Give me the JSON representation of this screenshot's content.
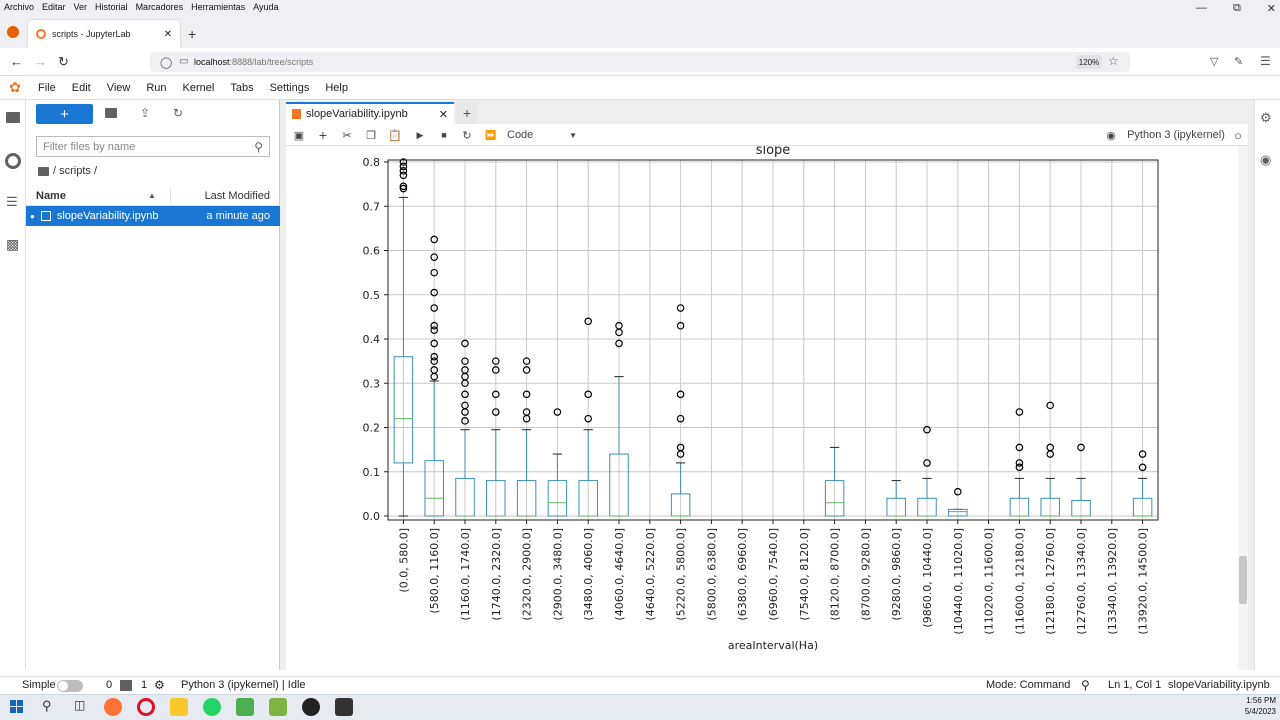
{
  "firefox_menu": [
    "Archivo",
    "Editar",
    "Ver",
    "Historial",
    "Marcadores",
    "Herramientas",
    "Ayuda"
  ],
  "browser_tab": {
    "title": "scripts - JupyterLab"
  },
  "url": {
    "host": "localhost",
    "path": ":8888/lab/tree/scripts"
  },
  "zoom": "120%",
  "jl_menu": [
    "File",
    "Edit",
    "View",
    "Run",
    "Kernel",
    "Tabs",
    "Settings",
    "Help"
  ],
  "filebrowser": {
    "new_label": "+",
    "filter_placeholder": "Filter files by name",
    "breadcrumb": "/ scripts /",
    "col_name": "Name",
    "col_modified": "Last Modified",
    "files": [
      {
        "name": "slopeVariability.ipynb",
        "modified": "a minute ago"
      }
    ]
  },
  "notebook": {
    "tab_title": "slopeVariability.ipynb",
    "cell_type": "Code",
    "kernel": "Python 3 (ipykernel)"
  },
  "chart_data": {
    "type": "boxplot",
    "title": "slope",
    "xlabel": "areaInterval(Ha)",
    "ylim": [
      0,
      0.8
    ],
    "yticks": [
      "0.0",
      "0.1",
      "0.2",
      "0.3",
      "0.4",
      "0.5",
      "0.6",
      "0.7",
      "0.8"
    ],
    "grid": true,
    "categories": [
      "(0.0, 580.0]",
      "(580.0, 1160.0]",
      "(1160.0, 1740.0]",
      "(1740.0, 2320.0]",
      "(2320.0, 2900.0]",
      "(2900.0, 3480.0]",
      "(3480.0, 4060.0]",
      "(4060.0, 4640.0]",
      "(4640.0, 5220.0]",
      "(5220.0, 5800.0]",
      "(5800.0, 6380.0]",
      "(6380.0, 6960.0]",
      "(6960.0, 7540.0]",
      "(7540.0, 8120.0]",
      "(8120.0, 8700.0]",
      "(8700.0, 9280.0]",
      "(9280.0, 9860.0]",
      "(9860.0, 10440.0]",
      "(10440.0, 11020.0]",
      "(11020.0, 11600.0]",
      "(11600.0, 12180.0]",
      "(12180.0, 12760.0]",
      "(12760.0, 13340.0]",
      "(13340.0, 13920.0]",
      "(13920.0, 14500.0]"
    ],
    "boxes": [
      {
        "q1": 0.12,
        "median": 0.22,
        "q3": 0.36,
        "whisker_low": 0,
        "whisker_high": 0.72,
        "outliers": [
          0.74,
          0.745,
          0.77,
          0.78,
          0.79,
          0.8
        ]
      },
      {
        "q1": 0,
        "median": 0.04,
        "q3": 0.125,
        "whisker_low": 0,
        "whisker_high": 0.305,
        "outliers": [
          0.315,
          0.33,
          0.35,
          0.36,
          0.39,
          0.42,
          0.43,
          0.47,
          0.505,
          0.55,
          0.585,
          0.625
        ]
      },
      {
        "q1": 0,
        "median": 0,
        "q3": 0.085,
        "whisker_low": 0,
        "whisker_high": 0.195,
        "outliers": [
          0.215,
          0.235,
          0.25,
          0.275,
          0.3,
          0.315,
          0.33,
          0.35,
          0.39
        ]
      },
      {
        "q1": 0,
        "median": 0,
        "q3": 0.08,
        "whisker_low": 0,
        "whisker_high": 0.195,
        "outliers": [
          0.235,
          0.275,
          0.33,
          0.35
        ]
      },
      {
        "q1": 0,
        "median": 0,
        "q3": 0.08,
        "whisker_low": 0,
        "whisker_high": 0.195,
        "outliers": [
          0.22,
          0.235,
          0.275,
          0.33,
          0.35
        ]
      },
      {
        "q1": 0,
        "median": 0.03,
        "q3": 0.08,
        "whisker_low": 0,
        "whisker_high": 0.14,
        "outliers": [
          0.235
        ]
      },
      {
        "q1": 0,
        "median": 0,
        "q3": 0.08,
        "whisker_low": 0,
        "whisker_high": 0.195,
        "outliers": [
          0.22,
          0.275,
          0.44
        ]
      },
      {
        "q1": 0,
        "median": 0,
        "q3": 0.14,
        "whisker_low": 0,
        "whisker_high": 0.315,
        "outliers": [
          0.39,
          0.415,
          0.43
        ]
      },
      null,
      {
        "q1": 0,
        "median": 0,
        "q3": 0.05,
        "whisker_low": 0,
        "whisker_high": 0.12,
        "outliers": [
          0.14,
          0.155,
          0.22,
          0.275,
          0.43,
          0.47
        ]
      },
      null,
      null,
      null,
      null,
      {
        "q1": 0,
        "median": 0.03,
        "q3": 0.08,
        "whisker_low": 0,
        "whisker_high": 0.155,
        "outliers": []
      },
      null,
      {
        "q1": 0,
        "median": 0,
        "q3": 0.04,
        "whisker_low": 0,
        "whisker_high": 0.08,
        "outliers": []
      },
      {
        "q1": 0,
        "median": 0,
        "q3": 0.04,
        "whisker_low": 0,
        "whisker_high": 0.085,
        "outliers": [
          0.12,
          0.195
        ]
      },
      {
        "q1": 0,
        "median": 0.01,
        "q3": 0.015,
        "whisker_low": 0,
        "whisker_high": 0.015,
        "outliers": [
          0.055
        ]
      },
      null,
      {
        "q1": 0,
        "median": 0,
        "q3": 0.04,
        "whisker_low": 0,
        "whisker_high": 0.085,
        "outliers": [
          0.11,
          0.12,
          0.155,
          0.235
        ]
      },
      {
        "q1": 0,
        "median": 0,
        "q3": 0.04,
        "whisker_low": 0,
        "whisker_high": 0.085,
        "outliers": [
          0.14,
          0.155,
          0.25
        ]
      },
      {
        "q1": 0,
        "median": 0,
        "q3": 0.035,
        "whisker_low": 0,
        "whisker_high": 0.085,
        "outliers": [
          0.155
        ]
      },
      null,
      {
        "q1": 0,
        "median": 0,
        "q3": 0.04,
        "whisker_low": 0,
        "whisker_high": 0.085,
        "outliers": [
          0.11,
          0.14
        ]
      }
    ],
    "colors": {
      "box": "#3a8fb7",
      "median": "#5cb85c",
      "outlier": "#000000",
      "grid": "#c8c8c8"
    }
  },
  "status": {
    "mode_simple": "Simple",
    "count_a": "0",
    "count_b": "1",
    "kernel_status": "Python 3 (ipykernel) | Idle",
    "mode": "Mode: Command",
    "position": "Ln 1, Col 1",
    "file": "slopeVariability.ipynb"
  },
  "clock": {
    "time": "1:56 PM",
    "date": "5/4/2023"
  }
}
